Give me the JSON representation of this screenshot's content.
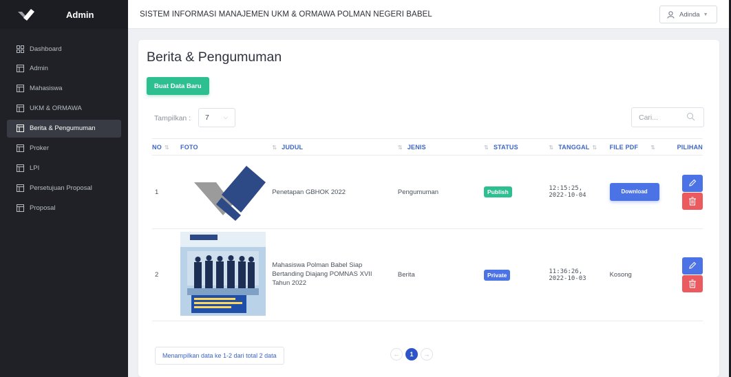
{
  "sidebar": {
    "brand_title": "Admin",
    "items": [
      {
        "label": "Dashboard",
        "icon": "dashboard-icon",
        "active": false
      },
      {
        "label": "Admin",
        "icon": "table-icon",
        "active": false
      },
      {
        "label": "Mahasiswa",
        "icon": "table-icon",
        "active": false
      },
      {
        "label": "UKM & ORMAWA",
        "icon": "table-icon",
        "active": false
      },
      {
        "label": "Berita & Pengumuman",
        "icon": "table-icon",
        "active": true
      },
      {
        "label": "Proker",
        "icon": "table-icon",
        "active": false
      },
      {
        "label": "LPI",
        "icon": "table-icon",
        "active": false
      },
      {
        "label": "Persetujuan Proposal",
        "icon": "table-icon",
        "active": false
      },
      {
        "label": "Proposal",
        "icon": "table-icon",
        "active": false
      }
    ]
  },
  "topbar": {
    "title": "SISTEM INFORMASI MANAJEMEN UKM & ORMAWA POLMAN NEGERI BABEL",
    "user_name": "Adinda"
  },
  "main": {
    "page_title": "Berita & Pengumuman",
    "new_button": "Buat Data Baru",
    "show_label": "Tampilkan :",
    "show_value": "7",
    "search_placeholder": "Cari...",
    "columns": [
      "NO",
      "FOTO",
      "JUDUL",
      "JENIS",
      "STATUS",
      "TANGGAL",
      "FILE PDF",
      "PILIHAN"
    ],
    "rows": [
      {
        "no": "1",
        "judul": "Penetapan GBHOK 2022",
        "jenis": "Pengumuman",
        "status": "Publish",
        "time": "12:15:25,",
        "date": "2022-10-04",
        "pdf": "Download"
      },
      {
        "no": "2",
        "judul": "Mahasiswa Polman Babel Siap Bertanding Diajang POMNAS XVII Tahun 2022",
        "jenis": "Berita",
        "status": "Private",
        "time": "11:36:26,",
        "date": "2022-10-03",
        "pdf": "Kosong"
      }
    ],
    "info_text": "Menampilkan data ke 1-2 dari total 2 data",
    "pagination": {
      "prev": "←",
      "current": "1",
      "next": "→"
    }
  },
  "colors": {
    "sidebar_bg": "#1f2126",
    "accent_green": "#2ebf91",
    "accent_blue": "#4c73e6",
    "danger_red": "#ea5a5f",
    "header_blue": "#3b64c8"
  }
}
